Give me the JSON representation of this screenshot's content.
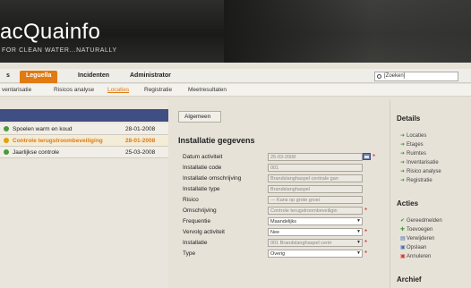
{
  "header": {
    "logo": "acQuainfo",
    "tagline": "FOR CLEAN WATER...NATURALLY"
  },
  "menu": {
    "tabs": [
      {
        "label": "s",
        "active": false
      },
      {
        "label": "Leguella",
        "active": true
      },
      {
        "label": "Incidenten",
        "active": false
      },
      {
        "label": "Administrator",
        "active": false
      }
    ],
    "search_placeholder": "[Zoeken]"
  },
  "submenu": {
    "items": [
      {
        "label": "ventarisatie",
        "active": false
      },
      {
        "label": "Risicos analyse",
        "active": false
      },
      {
        "label": "Locaties",
        "active": true
      },
      {
        "label": "Registratie",
        "active": false
      },
      {
        "label": "Meetresultaten",
        "active": false
      }
    ]
  },
  "list": {
    "rows": [
      {
        "name": "Spoelen warm en koud",
        "date": "28-01-2008",
        "selected": false
      },
      {
        "name": "Controle terugstroombeveiliging",
        "date": "28-01-2008",
        "selected": true
      },
      {
        "name": "Jaarlijkse controle",
        "date": "25-03-2008",
        "selected": false
      }
    ]
  },
  "main": {
    "algemeen_button": "Algemeen",
    "section_title": "Installatie gegevens",
    "fields": [
      {
        "label": "Datum activiteit",
        "value": "25-03-2008",
        "select": false,
        "required": true
      },
      {
        "label": "Installatie code",
        "value": "001",
        "select": false,
        "required": false
      },
      {
        "label": "Installatie omschrijving",
        "value": "Brandslanghaspel centrale gan",
        "select": false,
        "required": false
      },
      {
        "label": "Installatie type",
        "value": "Brandslanghaspel",
        "select": false,
        "required": false
      },
      {
        "label": "Risico",
        "value": "--- Kans op grote groei",
        "select": false,
        "required": false
      },
      {
        "label": "Omschrijving",
        "value": "Controle terugstroombeveiligin",
        "select": false,
        "required": true
      },
      {
        "label": "Frequentie",
        "value": "Maandelijks",
        "select": true,
        "required": false
      },
      {
        "label": "Vervolg activiteit",
        "value": "Nee",
        "select": true,
        "required": true
      },
      {
        "label": "Installatie",
        "value": "001 Brandslanghaspel centr",
        "select": true,
        "required": true
      },
      {
        "label": "Type",
        "value": "Overig",
        "select": true,
        "required": true
      }
    ]
  },
  "right": {
    "details_title": "Details",
    "details_items": [
      "Locaties",
      "Etages",
      "Ruimtes",
      "Inventarisatie",
      "Risico analyse",
      "Registratie"
    ],
    "acties_title": "Acties",
    "acties_items": [
      {
        "label": "Gereedmelden",
        "icon": "check-icon"
      },
      {
        "label": "Toevoegen",
        "icon": "plus-icon"
      },
      {
        "label": "Verwijderen",
        "icon": "delete-icon"
      },
      {
        "label": "Opslaan",
        "icon": "save-icon"
      },
      {
        "label": "Annuleren",
        "icon": "cancel-icon"
      }
    ],
    "archief_title": "Archief"
  }
}
